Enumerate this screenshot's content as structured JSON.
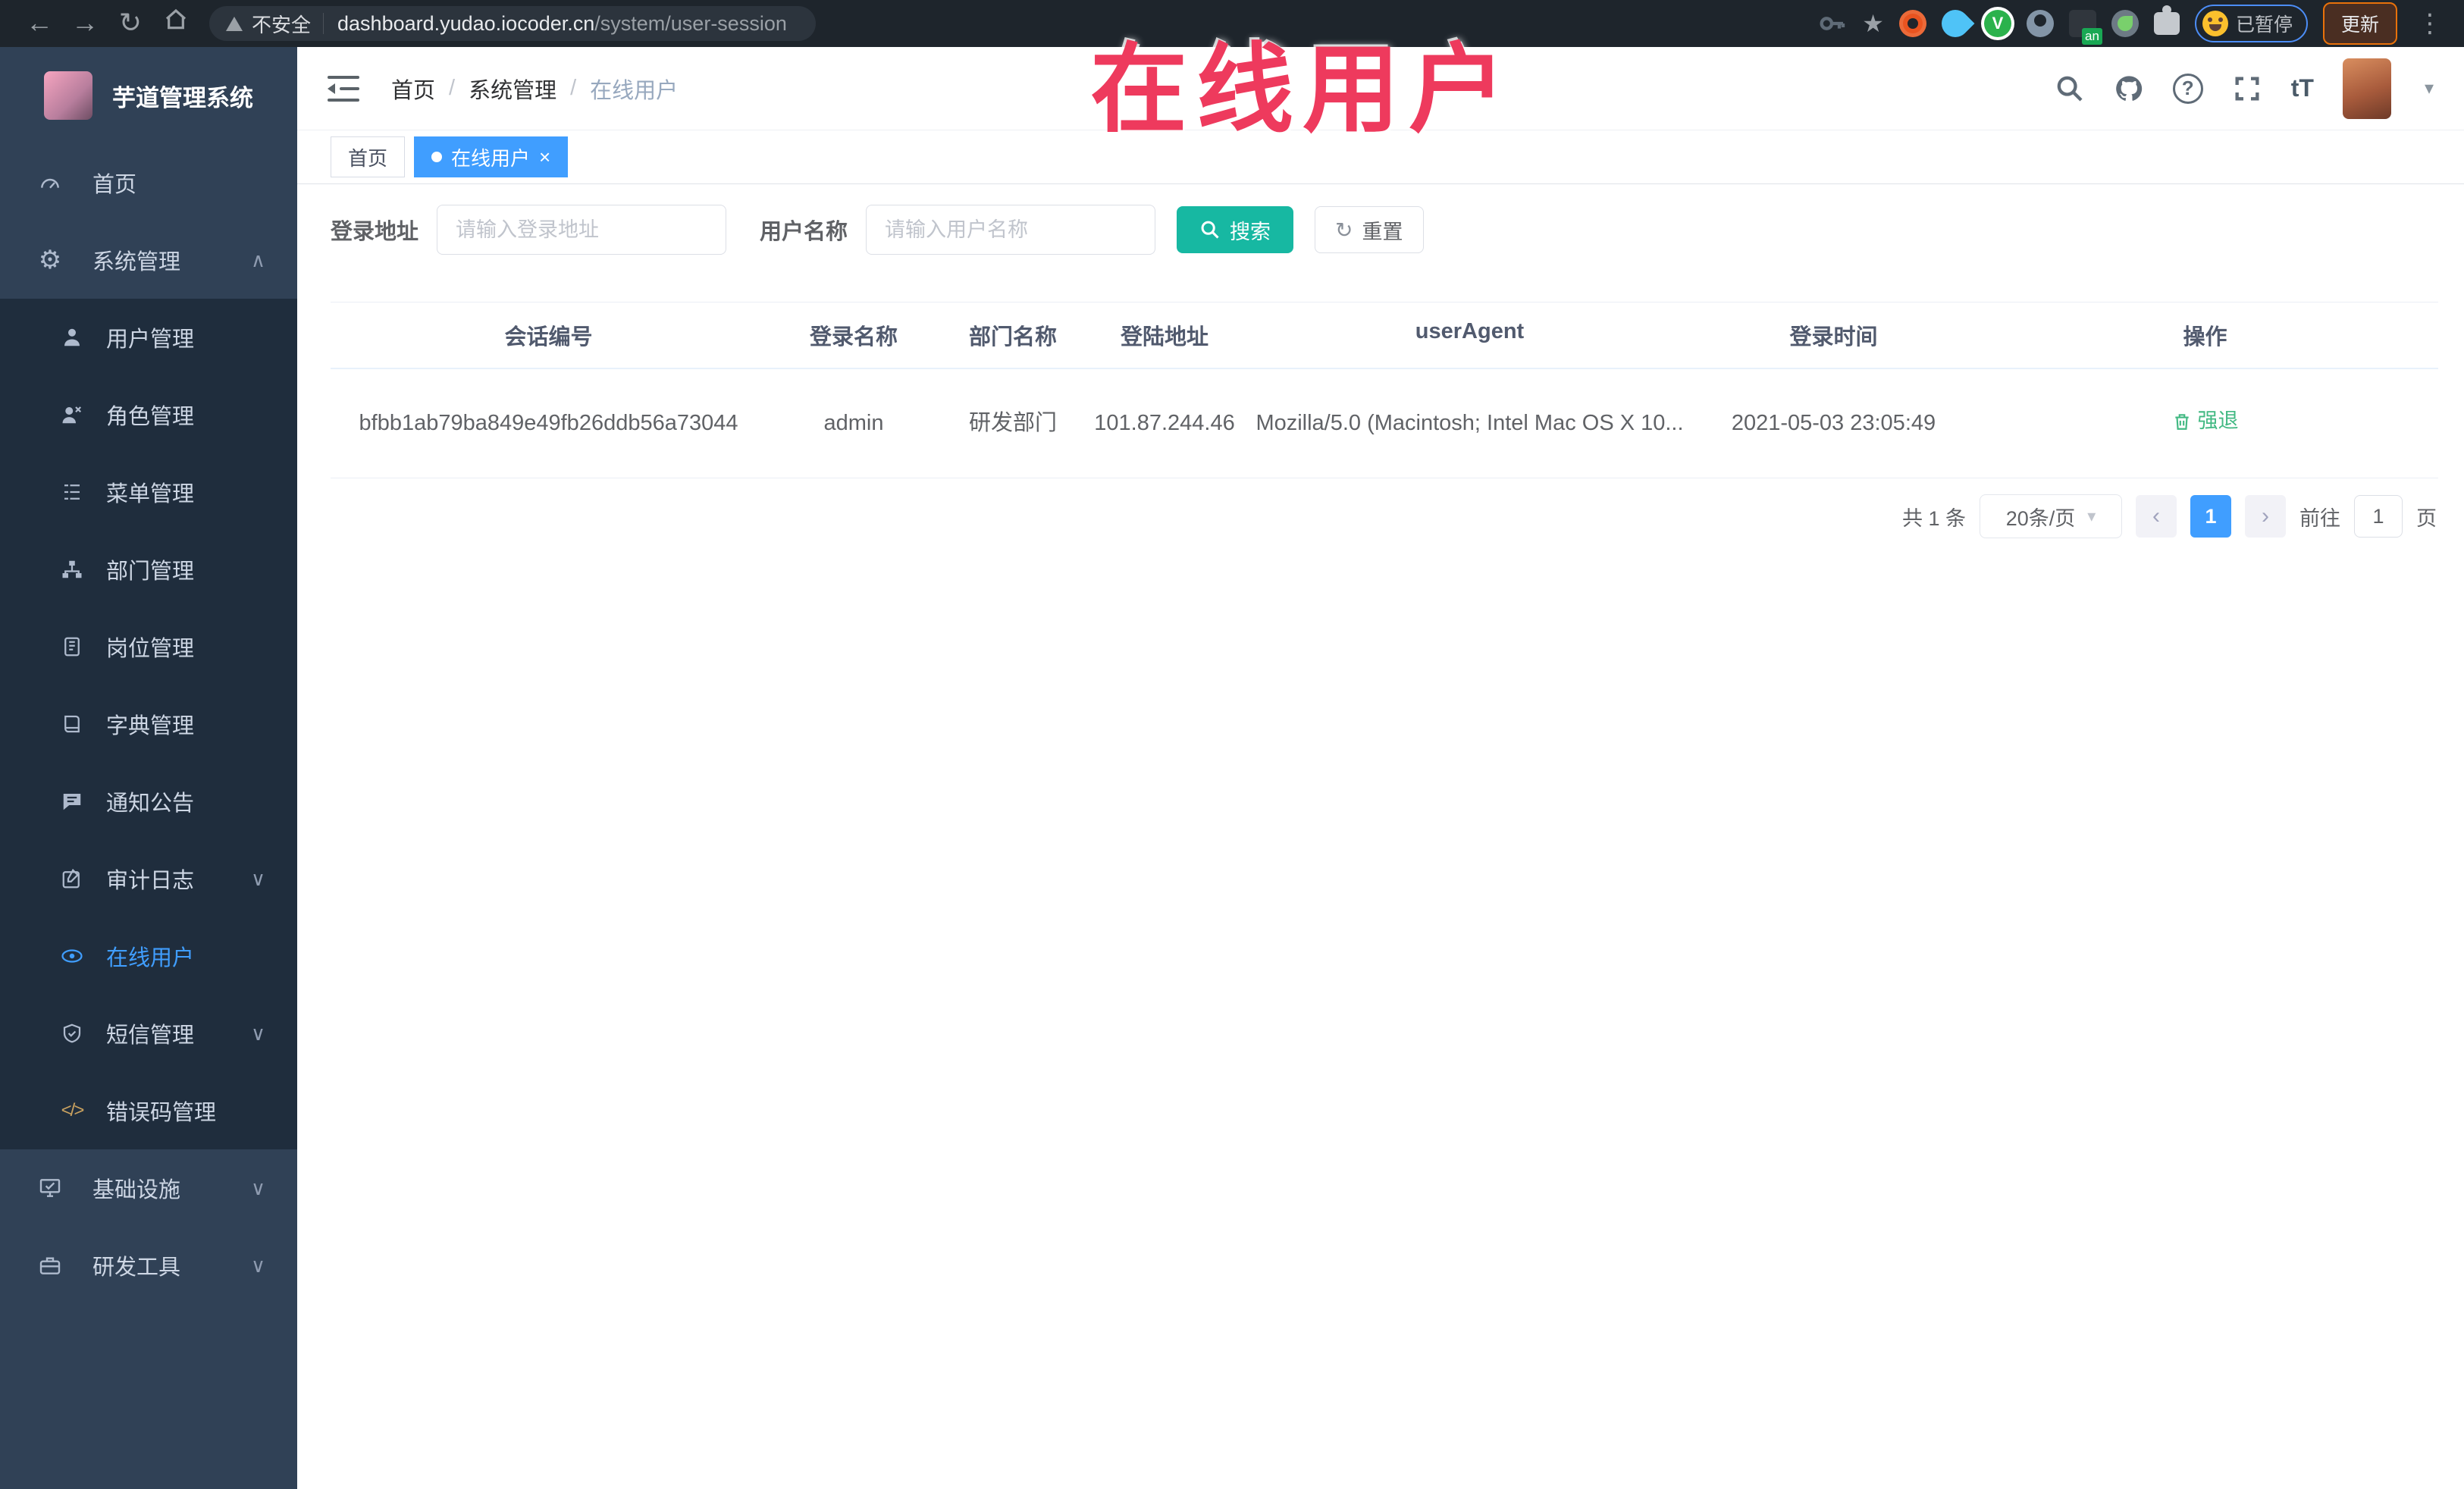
{
  "browser": {
    "security_label": "不安全",
    "url_domain": "dashboard.yudao.iocoder.cn",
    "url_path": "/system/user-session",
    "extension_badge": "an",
    "paused_label": "已暂停",
    "update_label": "更新"
  },
  "overlay_title": "在线用户",
  "glyphs": {
    "back": "←",
    "forward": "→",
    "reload": "↻",
    "star": "★",
    "dots": "⋮",
    "gear": "⚙",
    "code": "</>",
    "caret_up": "∧",
    "caret_down": "∨",
    "breadcrumb_sep": "/",
    "question_mark": "?",
    "font_size": "tT",
    "avatar_caret": "▾",
    "close": "×",
    "reset": "↻",
    "select_caret": "▾",
    "prev": "‹",
    "next": "›"
  },
  "app": {
    "title": "芋道管理系统",
    "breadcrumb": [
      "首页",
      "系统管理",
      "在线用户"
    ]
  },
  "sidebar": {
    "top": [
      {
        "label": "首页"
      },
      {
        "label": "系统管理"
      }
    ],
    "submenu": [
      "用户管理",
      "角色管理",
      "菜单管理",
      "部门管理",
      "岗位管理",
      "字典管理",
      "通知公告",
      "审计日志",
      "在线用户",
      "短信管理",
      "错误码管理"
    ],
    "bottom": [
      "基础设施",
      "研发工具"
    ],
    "active_item": "在线用户",
    "accent_color": "#409eff"
  },
  "tabs": [
    {
      "label": "首页",
      "active": false
    },
    {
      "label": "在线用户",
      "active": true
    }
  ],
  "filters": {
    "login_address_label": "登录地址",
    "login_address_placeholder": "请输入登录地址",
    "username_label": "用户名称",
    "username_placeholder": "请输入用户名称",
    "search_label": "搜索",
    "reset_label": "重置"
  },
  "table": {
    "columns": [
      "会话编号",
      "登录名称",
      "部门名称",
      "登陆地址",
      "userAgent",
      "登录时间",
      "操作"
    ],
    "row": {
      "session_id": "bfbb1ab79ba849e49fb26ddb56a73044",
      "login_name": "admin",
      "dept_name": "研发部门",
      "login_address": "101.87.244.46",
      "user_agent": "Mozilla/5.0 (Macintosh; Intel Mac OS X 10...",
      "login_time": "2021-05-03 23:05:49",
      "action_label": "强退"
    }
  },
  "pagination": {
    "total_label": "共 1 条",
    "page_size_label": "20条/页",
    "current_page": "1",
    "goto_label": "前往",
    "goto_value": "1",
    "page_unit_label": "页"
  }
}
